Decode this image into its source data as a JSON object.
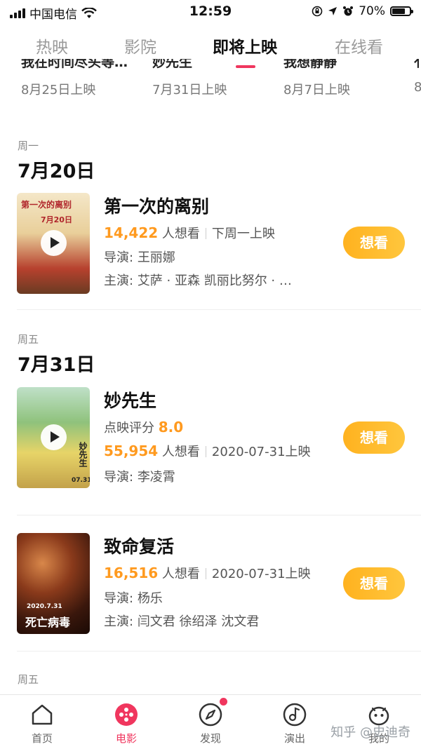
{
  "status_bar": {
    "carrier": "中国电信",
    "time": "12:59",
    "battery": "70%"
  },
  "tabs": [
    {
      "label": "热映"
    },
    {
      "label": "影院"
    },
    {
      "label": "即将上映"
    },
    {
      "label": "在线看"
    }
  ],
  "carousel": [
    {
      "title": "我在时间尽头等…",
      "date": "8月25日上映"
    },
    {
      "title": "妙先生",
      "date": "7月31日上映"
    },
    {
      "title": "我想静静",
      "date": "8月7日上映"
    },
    {
      "title": "亻",
      "date": "8"
    }
  ],
  "sections": [
    {
      "weekday": "周一",
      "date": "7月20日",
      "movies": [
        {
          "title": "第一次的离别",
          "want_count": "14,422",
          "want_suffix": "人想看",
          "release": "下周一上映",
          "director_label": "导演:",
          "director": "王丽娜",
          "cast_label": "主演:",
          "cast": "艾萨 · 亚森  凯丽比努尔 · …",
          "poster_text": "第一次的离别",
          "poster_date": "7月20日"
        }
      ]
    },
    {
      "weekday": "周五",
      "date": "7月31日",
      "movies": [
        {
          "title": "妙先生",
          "score_label": "点映评分",
          "score": "8.0",
          "want_count": "55,954",
          "want_suffix": "人想看",
          "release": "2020-07-31上映",
          "director_label": "导演:",
          "director": "李凌霄",
          "poster_text": "妙先生",
          "poster_date": "07.31"
        },
        {
          "title": "致命复活",
          "want_count": "16,516",
          "want_suffix": "人想看",
          "release": "2020-07-31上映",
          "director_label": "导演:",
          "director": "杨乐",
          "cast_label": "主演:",
          "cast": "闫文君  徐绍泽  沈文君",
          "poster_text": "死亡病毒",
          "poster_date": "2020.7.31"
        }
      ]
    },
    {
      "weekday": "周五"
    }
  ],
  "want_button_label": "想看",
  "bottom_nav": [
    {
      "label": "首页",
      "icon": "home-icon"
    },
    {
      "label": "电影",
      "icon": "film-reel-icon"
    },
    {
      "label": "发现",
      "icon": "compass-icon"
    },
    {
      "label": "演出",
      "icon": "music-note-icon"
    },
    {
      "label": "我的",
      "icon": "profile-face-icon"
    }
  ],
  "watermark": "知乎 @史迪奇",
  "colors": {
    "accent": "#f0365e",
    "orange": "#ff9a1f",
    "button": "#ffb21f"
  }
}
